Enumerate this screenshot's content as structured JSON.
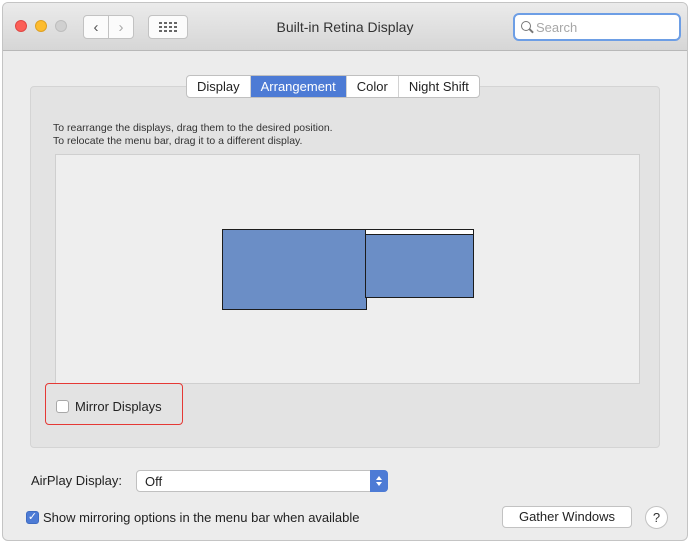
{
  "window": {
    "title": "Built-in Retina Display"
  },
  "toolbar": {
    "back_icon": "chevron-left-icon",
    "back_glyph": "‹",
    "forward_icon": "chevron-right-icon",
    "forward_glyph": "›",
    "grid_icon": "show-all-grid-icon"
  },
  "search": {
    "placeholder": "Search"
  },
  "tabs": [
    {
      "label": "Display",
      "active": false
    },
    {
      "label": "Arrangement",
      "active": true
    },
    {
      "label": "Color",
      "active": false
    },
    {
      "label": "Night Shift",
      "active": false
    }
  ],
  "arrangement": {
    "instruction_1": "To rearrange the displays, drag them to the desired position.",
    "instruction_2": "To relocate the menu bar, drag it to a different display.",
    "mirror_label": "Mirror Displays",
    "mirror_checked": false
  },
  "airplay": {
    "label": "AirPlay Display:",
    "value": "Off"
  },
  "show_mirroring": {
    "label": "Show mirroring options in the menu bar when available",
    "checked": true,
    "check_glyph": "✓"
  },
  "buttons": {
    "gather_windows": "Gather Windows",
    "help": "?"
  },
  "colors": {
    "accent": "#4d7bd5",
    "display_fill": "#6b8ec6",
    "highlight": "#e53935"
  }
}
